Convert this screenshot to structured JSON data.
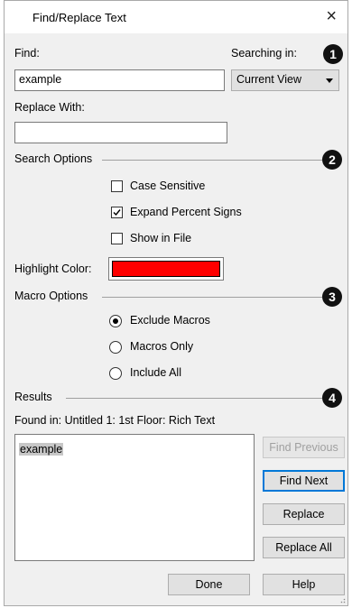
{
  "window": {
    "title": "Find/Replace Text",
    "close_glyph": "×"
  },
  "find": {
    "label": "Find:",
    "value": "example"
  },
  "searching_in": {
    "label": "Searching in:",
    "selected": "Current View"
  },
  "replace": {
    "label": "Replace With:",
    "value": ""
  },
  "search_options": {
    "label": "Search Options",
    "case_sensitive": {
      "label": "Case Sensitive",
      "checked": false
    },
    "expand_percent": {
      "label": "Expand Percent Signs",
      "checked": true
    },
    "show_in_file": {
      "label": "Show in File",
      "checked": false
    }
  },
  "highlight": {
    "label": "Highlight Color:",
    "color": "#ff0000"
  },
  "macro_options": {
    "label": "Macro Options",
    "exclude": {
      "label": "Exclude Macros",
      "selected": true
    },
    "only": {
      "label": "Macros Only",
      "selected": false
    },
    "include_all": {
      "label": "Include All",
      "selected": false
    }
  },
  "results": {
    "label": "Results",
    "found_in": "Found in: Untitled 1: 1st Floor: Rich Text",
    "items": [
      "example"
    ]
  },
  "buttons": {
    "find_previous": "Find Previous",
    "find_next": "Find Next",
    "replace": "Replace",
    "replace_all": "Replace All",
    "done": "Done",
    "help": "Help"
  },
  "callouts": [
    "1",
    "2",
    "3",
    "4"
  ],
  "colors": {
    "accent": "#0078d7",
    "dialog_bg": "#f0f0f0",
    "callout": "#111111"
  }
}
